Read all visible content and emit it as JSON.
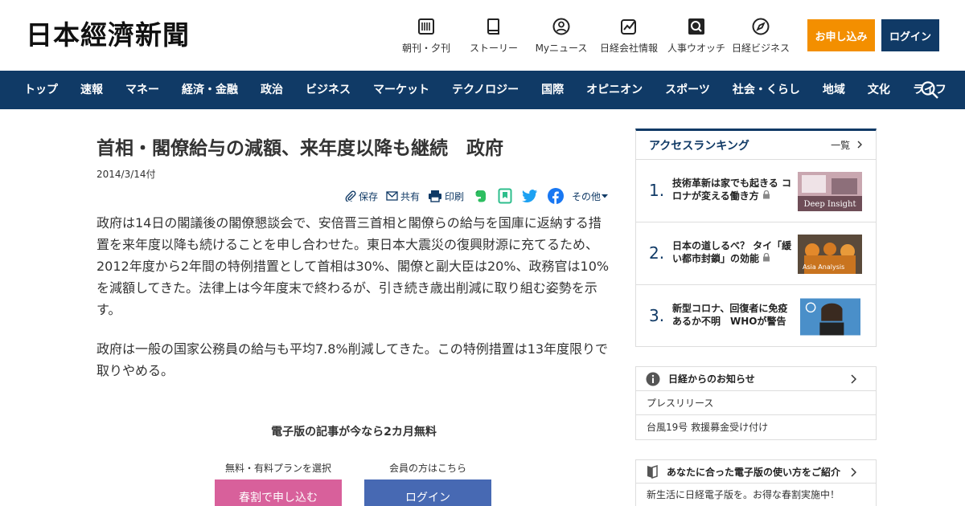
{
  "header": {
    "logo": "日本經濟新聞",
    "links": [
      {
        "label": "朝刊・夕刊",
        "icon": "newspaper-icon"
      },
      {
        "label": "ストーリー",
        "icon": "book-icon"
      },
      {
        "label": "Myニュース",
        "icon": "user-icon"
      },
      {
        "label": "日経会社情報",
        "icon": "chart-icon"
      },
      {
        "label": "人事ウオッチ",
        "icon": "search-icon"
      },
      {
        "label": "日経ビジネス",
        "icon": "compass-icon"
      }
    ],
    "apply_label": "お申し込み",
    "login_label": "ログイン"
  },
  "nav": {
    "items": [
      "トップ",
      "速報",
      "マネー",
      "経済・金融",
      "政治",
      "ビジネス",
      "マーケット",
      "テクノロジー",
      "国際",
      "オピニオン",
      "スポーツ",
      "社会・くらし",
      "地域",
      "文化",
      "ライフ"
    ]
  },
  "article": {
    "title": "首相・閣僚給与の減額、来年度以降も継続　政府",
    "date": "2014/3/14付",
    "share": {
      "save": "保存",
      "share": "共有",
      "print": "印刷",
      "more": "その他"
    },
    "paragraphs": [
      "政府は14日の閣議後の閣僚懇談会で、安倍晋三首相と閣僚らの給与を国庫に返納する措置を来年度以降も続けることを申し合わせた。東日本大震災の復興財源に充てるため、2012年度から2年間の特例措置として首相は30%、閣僚と副大臣は20%、政務官は10%を減額してきた。法律上は今年度末で終わるが、引き続き歳出削減に取り組む姿勢を示す。",
      "政府は一般の国家公務員の給与も平均7.8%削減してきた。この特例措置は13年度限りで取りやめる。"
    ]
  },
  "promo": {
    "title": "電子版の記事が今なら2カ月無料",
    "plan_label": "無料・有料プランを選択",
    "member_label": "会員の方はこちら",
    "signup_button": "春割で申し込む",
    "login_button": "ログイン"
  },
  "sidebar": {
    "ranking": {
      "title": "アクセスランキング",
      "more": "一覧",
      "items": [
        {
          "rank": "1.",
          "title": "技術革新は家でも起きる コロナが変える働き方",
          "thumb_text": "Deep Insight"
        },
        {
          "rank": "2.",
          "title": "日本の道しるべ？ タイ「緩い都市封鎖」の効能",
          "thumb_text": "Asia Analysis"
        },
        {
          "rank": "3.",
          "title": "新型コロナ、回復者に免疫あるか不明　WHOが警告",
          "thumb_text": ""
        }
      ]
    },
    "notice": {
      "title": "日経からのお知らせ",
      "items": [
        "プレスリリース",
        "台風19号 救援募金受け付け"
      ]
    },
    "guide": {
      "title": "あなたに合った電子版の使い方をご紹介",
      "items": [
        "新生活に日経電子版を。お得な春割実施中！"
      ]
    }
  }
}
